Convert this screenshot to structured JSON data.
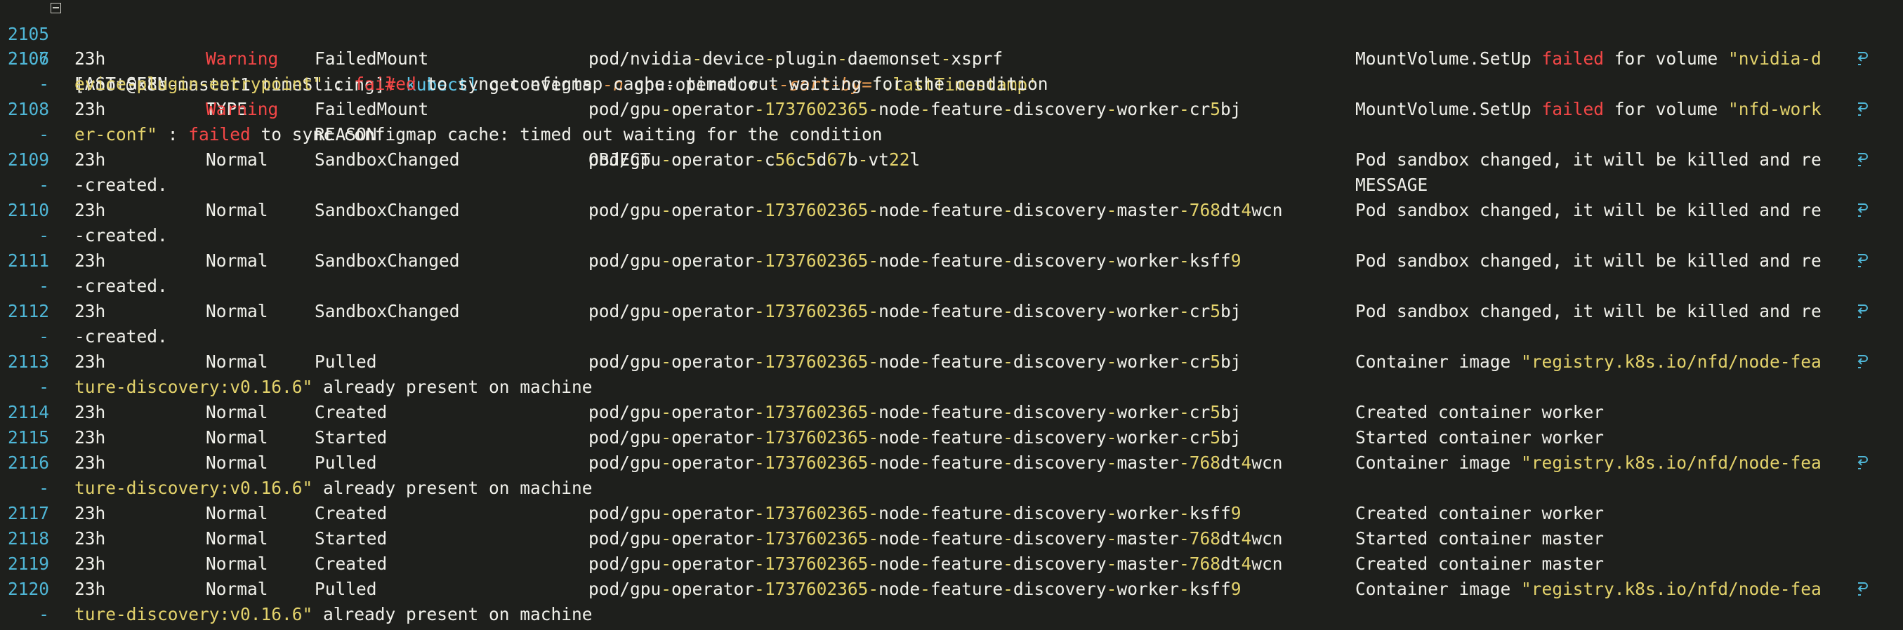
{
  "prompt": {
    "line_number": "2105",
    "text": "[root@k8s-master1 timeSlicing]",
    "hash": "#",
    "command": "kubectl",
    "args_a": " get events ",
    "opt_n": "-n",
    "namespace": " gpu-operator ",
    "opt_sort": "--sort-by",
    "eq": "=",
    "sort_value": "'.lastTimestamp'"
  },
  "header": {
    "line_number": "2106",
    "last_seen": "LAST SEEN",
    "type": "TYPE",
    "reason": "REASON",
    "object": "OBJECT",
    "message": "MESSAGE"
  },
  "wrap_marker": "-",
  "events": [
    {
      "ln": "2107",
      "last_seen": "23h",
      "type": "Warning",
      "reason": "FailedMount",
      "object": "pod/nvidia-device-plugin-daemonset-xsprf",
      "message_parts": [
        "MountVolume.SetUp ",
        "failed",
        " for volume ",
        "\"nvidia-d"
      ],
      "continuation_parts": [
        "evice-plugin-entrypoint\"",
        " : ",
        "failed",
        " to sync configmap cache: timed out waiting for the condition"
      ]
    },
    {
      "ln": "2108",
      "last_seen": "23h",
      "type": "Warning",
      "reason": "FailedMount",
      "object": "pod/gpu-operator-1737602365-node-feature-discovery-worker-cr5bj",
      "message_parts": [
        "MountVolume.SetUp ",
        "failed",
        " for volume ",
        "\"nfd-work"
      ],
      "continuation_parts": [
        "er-conf\"",
        " : ",
        "failed",
        " to sync configmap cache: timed out waiting for the condition"
      ]
    },
    {
      "ln": "2109",
      "last_seen": "23h",
      "type": "Normal",
      "reason": "SandboxChanged",
      "object": "pod/gpu-operator-c56c5d67b-vt22l",
      "message": "Pod sandbox changed, it will be killed and re",
      "continuation": "-created."
    },
    {
      "ln": "2110",
      "last_seen": "23h",
      "type": "Normal",
      "reason": "SandboxChanged",
      "object": "pod/gpu-operator-1737602365-node-feature-discovery-master-768dt4wcn",
      "message": "Pod sandbox changed, it will be killed and re",
      "continuation": "-created."
    },
    {
      "ln": "2111",
      "last_seen": "23h",
      "type": "Normal",
      "reason": "SandboxChanged",
      "object": "pod/gpu-operator-1737602365-node-feature-discovery-worker-ksff9",
      "message": "Pod sandbox changed, it will be killed and re",
      "continuation": "-created."
    },
    {
      "ln": "2112",
      "last_seen": "23h",
      "type": "Normal",
      "reason": "SandboxChanged",
      "object": "pod/gpu-operator-1737602365-node-feature-discovery-worker-cr5bj",
      "message": "Pod sandbox changed, it will be killed and re",
      "continuation": "-created."
    },
    {
      "ln": "2113",
      "last_seen": "23h",
      "type": "Normal",
      "reason": "Pulled",
      "object": "pod/gpu-operator-1737602365-node-feature-discovery-worker-cr5bj",
      "message_parts": [
        "Container image ",
        "\"registry.k8s.io/nfd/node-fea"
      ],
      "continuation_parts": [
        "ture-discovery:v0.16.6\"",
        " already present on machine"
      ]
    },
    {
      "ln": "2114",
      "last_seen": "23h",
      "type": "Normal",
      "reason": "Created",
      "object": "pod/gpu-operator-1737602365-node-feature-discovery-worker-cr5bj",
      "message": "Created container worker"
    },
    {
      "ln": "2115",
      "last_seen": "23h",
      "type": "Normal",
      "reason": "Started",
      "object": "pod/gpu-operator-1737602365-node-feature-discovery-worker-cr5bj",
      "message": "Started container worker"
    },
    {
      "ln": "2116",
      "last_seen": "23h",
      "type": "Normal",
      "reason": "Pulled",
      "object": "pod/gpu-operator-1737602365-node-feature-discovery-master-768dt4wcn",
      "message_parts": [
        "Container image ",
        "\"registry.k8s.io/nfd/node-fea"
      ],
      "continuation_parts": [
        "ture-discovery:v0.16.6\"",
        " already present on machine"
      ]
    },
    {
      "ln": "2117",
      "last_seen": "23h",
      "type": "Normal",
      "reason": "Created",
      "object": "pod/gpu-operator-1737602365-node-feature-discovery-worker-ksff9",
      "message": "Created container worker"
    },
    {
      "ln": "2118",
      "last_seen": "23h",
      "type": "Normal",
      "reason": "Started",
      "object": "pod/gpu-operator-1737602365-node-feature-discovery-master-768dt4wcn",
      "message": "Started container master"
    },
    {
      "ln": "2119",
      "last_seen": "23h",
      "type": "Normal",
      "reason": "Created",
      "object": "pod/gpu-operator-1737602365-node-feature-discovery-master-768dt4wcn",
      "message": "Created container master"
    },
    {
      "ln": "2120",
      "last_seen": "23h",
      "type": "Normal",
      "reason": "Pulled",
      "object": "pod/gpu-operator-1737602365-node-feature-discovery-worker-ksff9",
      "message_parts": [
        "Container image ",
        "\"registry.k8s.io/nfd/node-fea"
      ],
      "continuation_parts": [
        "ture-discovery:v0.16.6\"",
        " already present on machine"
      ]
    }
  ],
  "colors": {
    "background": "#1e1f1c",
    "foreground": "#f0f0ea",
    "line_number": "#4fb6d6",
    "warning": "#f44747",
    "string": "#e3d26b",
    "option": "#e69a52",
    "command": "#5ec4e6"
  },
  "icons": {
    "fold": "fold-collapse-icon",
    "wrap": "line-wrap-icon"
  }
}
